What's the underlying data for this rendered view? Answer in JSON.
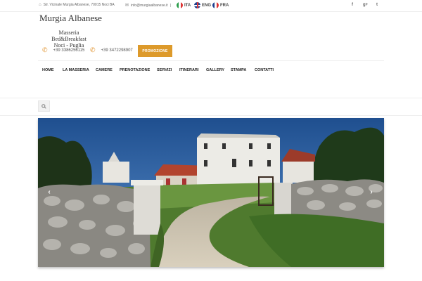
{
  "topbar": {
    "address": "Str. Vicinale Murgia Albanese, 70015 Noci BA",
    "email": "info@murgiaalbanese.it",
    "separator": "|",
    "languages": [
      {
        "code": "ITA",
        "flag": "flag-italy-icon"
      },
      {
        "code": "ENG",
        "flag": "flag-uk-icon"
      },
      {
        "code": "FRA",
        "flag": "flag-france-icon"
      }
    ],
    "social": [
      {
        "icon": "facebook-icon",
        "glyph": "f"
      },
      {
        "icon": "google-plus-icon",
        "glyph": "g+"
      },
      {
        "icon": "twitter-icon",
        "glyph": "t"
      }
    ]
  },
  "logo": {
    "title": "Murgia Albanese",
    "subtitle_line1": "Masseria Bed&Breakfast",
    "subtitle_line2": "Noci - Puglia"
  },
  "contact": {
    "phone1": "+39 3386256115",
    "phone2": "+39 3472298907",
    "promo_label": "PROMOZIONE"
  },
  "nav": {
    "items": [
      "HOME",
      "LA MASSERIA",
      "CAMERE",
      "PRENOTAZIONE",
      "SERVIZI",
      "ITINERARI",
      "GALLERY",
      "STAMPA",
      "CONTATTI"
    ]
  },
  "slider": {
    "prev_glyph": "‹",
    "next_glyph": "›"
  },
  "colors": {
    "accent": "#dd9a2b",
    "phone_icon": "#e0912a",
    "nav_text": "#222222"
  }
}
